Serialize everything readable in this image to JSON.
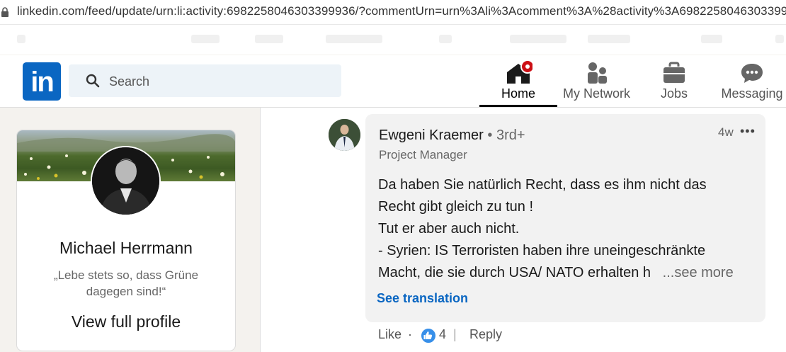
{
  "browser": {
    "url": "linkedin.com/feed/update/urn:li:activity:6982258046303399936/?commentUrn=urn%3Ali%3Acomment%3A%28activity%3A6982258046303399"
  },
  "nav": {
    "logo": "in",
    "search_placeholder": "Search",
    "items": [
      {
        "label": "Home",
        "icon": "home-icon",
        "active": true,
        "notification": true
      },
      {
        "label": "My Network",
        "icon": "network-icon",
        "active": false
      },
      {
        "label": "Jobs",
        "icon": "briefcase-icon",
        "active": false
      },
      {
        "label": "Messaging",
        "icon": "chat-icon",
        "active": false
      }
    ]
  },
  "profile": {
    "name": "Michael Herrmann",
    "quote": "„Lebe stets so, dass Grüne dagegen sind!“",
    "view_profile": "View full profile"
  },
  "comment": {
    "author": "Ewgeni Kraemer",
    "degree": " • 3rd+",
    "title": "Project Manager",
    "time": "4w",
    "more": "•••",
    "lines": [
      "Da haben Sie natürlich Recht, dass es ihm nicht das",
      "Recht gibt gleich zu tun !",
      "Tut er aber auch nicht.",
      "- Syrien: IS Terroristen haben ihre uneingeschränkte",
      "Macht, die sie durch USA/ NATO erhalten h"
    ],
    "see_more": "...see more",
    "see_translation": "See translation",
    "like": "Like",
    "dot": "·",
    "reaction_count": "4",
    "divider": "|",
    "reply": "Reply"
  },
  "colors": {
    "brand": "#0a66c2",
    "notification": "#cc1016",
    "reaction": "#378fe9"
  }
}
